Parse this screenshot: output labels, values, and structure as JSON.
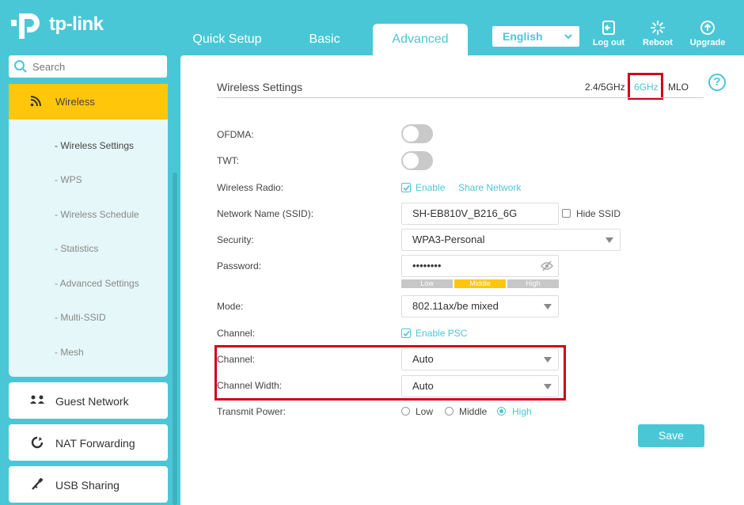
{
  "brand": {
    "name": "tp-link"
  },
  "nav": {
    "tabs": [
      {
        "label": "Quick Setup"
      },
      {
        "label": "Basic"
      },
      {
        "label": "Advanced",
        "active": true
      }
    ],
    "language": "English",
    "actions": {
      "logout": "Log out",
      "reboot": "Reboot",
      "upgrade": "Upgrade"
    }
  },
  "sidebar": {
    "search_placeholder": "Search",
    "wireless": {
      "label": "Wireless",
      "items": [
        {
          "label": "- Wireless Settings",
          "active": true
        },
        {
          "label": "- WPS"
        },
        {
          "label": "- Wireless Schedule"
        },
        {
          "label": "- Statistics"
        },
        {
          "label": "- Advanced Settings"
        },
        {
          "label": "- Multi-SSID"
        },
        {
          "label": "- Mesh"
        }
      ]
    },
    "sections": [
      {
        "label": "Guest Network",
        "icon": "guest-network-icon"
      },
      {
        "label": "NAT Forwarding",
        "icon": "nat-forwarding-icon"
      },
      {
        "label": "USB Sharing",
        "icon": "usb-sharing-icon"
      }
    ]
  },
  "main": {
    "title": "Wireless Settings",
    "bands": [
      "2.4/5GHz",
      "6GHz",
      "MLO"
    ],
    "active_band": "6GHz",
    "help": "?",
    "labels": {
      "ofdma": "OFDMA:",
      "twt": "TWT:",
      "radio": "Wireless Radio:",
      "ssid": "Network Name (SSID):",
      "security": "Security:",
      "password": "Password:",
      "mode": "Mode:",
      "channel_psc": "Channel:",
      "channel": "Channel:",
      "channel_width": "Channel Width:",
      "power": "Transmit Power:"
    },
    "ofdma_on": false,
    "twt_on": false,
    "radio_enable": "Enable",
    "share_network": "Share Network",
    "ssid_value": "SH-EB810V_B216_6G",
    "hide_ssid": "Hide SSID",
    "security_value": "WPA3-Personal",
    "password_value": "••••••••",
    "strength": {
      "levels": [
        "Low",
        "Middle",
        "High"
      ],
      "current": "Middle"
    },
    "mode_value": "802.11ax/be mixed",
    "enable_psc": "Enable PSC",
    "channel_value": "Auto",
    "channel_width_value": "Auto",
    "power": {
      "options": [
        "Low",
        "Middle",
        "High"
      ],
      "selected": "High"
    },
    "save": "Save"
  },
  "colors": {
    "accent": "#4ac7d6",
    "highlight": "#ffc60a",
    "annotation": "#d0021b"
  }
}
